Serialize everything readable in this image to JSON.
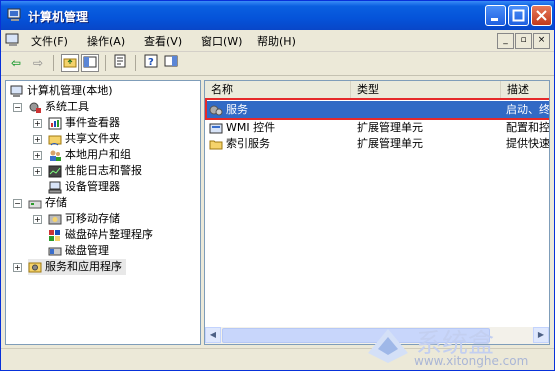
{
  "window": {
    "title": "计算机管理"
  },
  "menu": [
    "文件(F)",
    "操作(A)",
    "查看(V)",
    "窗口(W)",
    "帮助(H)"
  ],
  "tree": {
    "root": "计算机管理(本地)",
    "system_tools": "系统工具",
    "event_viewer": "事件查看器",
    "shared_folders": "共享文件夹",
    "local_users": "本地用户和组",
    "perf_logs": "性能日志和警报",
    "device_manager": "设备管理器",
    "storage": "存储",
    "removable": "可移动存储",
    "defrag": "磁盘碎片整理程序",
    "disk_mgmt": "磁盘管理",
    "services_apps": "服务和应用程序"
  },
  "list": {
    "columns": [
      "名称",
      "类型",
      "描述"
    ],
    "rows": [
      {
        "name": "服务",
        "type": "",
        "desc": "启动、终"
      },
      {
        "name": "WMI 控件",
        "type": "扩展管理单元",
        "desc": "配置和控"
      },
      {
        "name": "索引服务",
        "type": "扩展管理单元",
        "desc": "提供快速"
      }
    ]
  },
  "watermark": {
    "text": "系统盒",
    "url": "www.xitonghe.com"
  },
  "colors": {
    "titlebar": "#0553d9",
    "selection": "#316ac5",
    "highlight_box": "#e52a2a"
  }
}
